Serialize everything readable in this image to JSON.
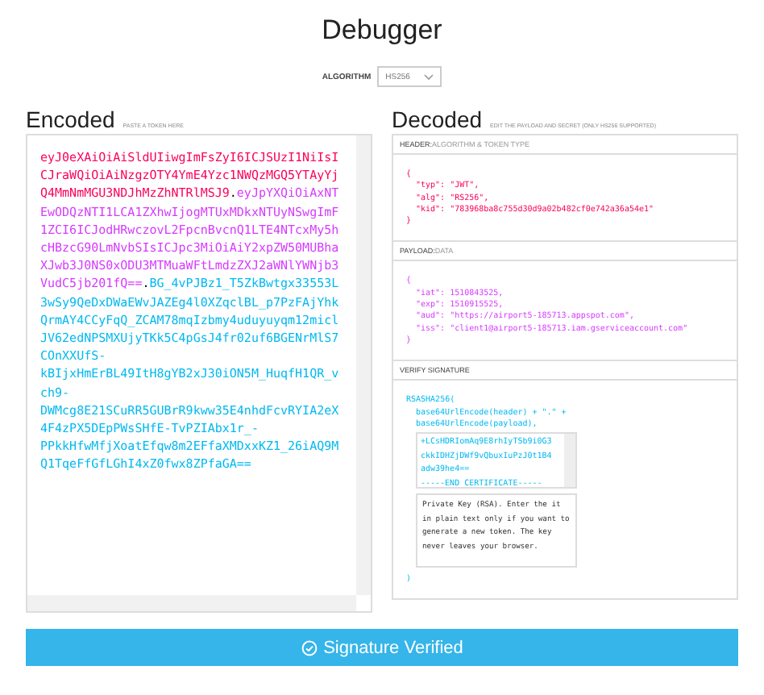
{
  "title": "Debugger",
  "algorithm": {
    "label": "ALGORITHM",
    "value": "HS256"
  },
  "encoded": {
    "heading": "Encoded",
    "hint": "PASTE A TOKEN HERE",
    "lines": [
      [
        {
          "color": "#fb015b",
          "text": "eyJ0eXAiOiAiSldUIiwgImFsZyI6ICJSUzI1NiIsI"
        }
      ],
      [
        {
          "color": "#fb015b",
          "text": "CJraWQiOiAiNzgzOTY4YmE4Yzc1NWQzMGQ5YTAyYj"
        }
      ],
      [
        {
          "color": "#fb015b",
          "text": "Q4MmNmMGU3NDJhMzZhNTRlMSJ9"
        },
        {
          "text": "."
        },
        {
          "color": "#d63aff",
          "text": "eyJpYXQiOiAxNT"
        }
      ],
      [
        {
          "color": "#d63aff",
          "text": "EwODQzNTI1LCA1ZXhwIjogMTUxMDkxNTUyNSwgImF"
        }
      ],
      [
        {
          "color": "#d63aff",
          "text": "1ZCI6ICJodHRwczovL2FpcnBvcnQ1LTE4NTcxMy5h"
        }
      ],
      [
        {
          "color": "#d63aff",
          "text": "cHBzcG90LmNvbSIsICJpc3MiOiAiY2xpZW50MUBha"
        }
      ],
      [
        {
          "color": "#d63aff",
          "text": "XJwb3J0NS0xODU3MTMuaWFtLmdzZXJ2aWNlYWNjb3"
        }
      ],
      [
        {
          "color": "#d63aff",
          "text": "VudC5jb201fQ=="
        },
        {
          "text": "."
        },
        {
          "color": "#00b9f1",
          "text": "BG_4vPJBz1_T5ZkBwtgx33553L"
        }
      ],
      [
        {
          "color": "#00b9f1",
          "text": "3wSy9QeDxDWaEWvJAZEg4l0XZqclBL_p7PzFAjYhk"
        }
      ],
      [
        {
          "color": "#00b9f1",
          "text": "QrmAY4CCyFqQ_ZCAM78mqIzbmy4uduyuyqm12micl"
        }
      ],
      [
        {
          "color": "#00b9f1",
          "text": "JV62edNPSMXUjyTKk5C4pGsJ4fr02uf6BGENrMlS7"
        }
      ],
      [
        {
          "color": "#00b9f1",
          "text": "COnXXUfS-"
        }
      ],
      [
        {
          "color": "#00b9f1",
          "text": "kBIjxHmErBL49ItH8gYB2xJ30iON5M_HuqfH1QR_v"
        }
      ],
      [
        {
          "color": "#00b9f1",
          "text": "ch9-"
        }
      ],
      [
        {
          "color": "#00b9f1",
          "text": "DWMcg8E21SCuRR5GUBrR9kww35E4nhdFcvRYIA2eX"
        }
      ],
      [
        {
          "color": "#00b9f1",
          "text": "4F4zPX5DEpPWsSHfE-TvPZIAbx1r_-"
        }
      ],
      [
        {
          "color": "#00b9f1",
          "text": "PPkkHfwMfjXoatEfqw8m2EFfaXMDxxKZ1_26iAQ9M"
        }
      ],
      [
        {
          "color": "#00b9f1",
          "text": "Q1TqeFfGfLGhI4xZ0fwx8ZPfaGA=="
        }
      ]
    ]
  },
  "decoded": {
    "heading": "Decoded",
    "hint": "EDIT THE PAYLOAD AND SECRET (ONLY HS256 SUPPORTED)",
    "sections": [
      {
        "kind": "json",
        "color": "#fb015b",
        "title": "HEADER:",
        "subtitle": "ALGORITHM & TOKEN TYPE",
        "open": "{",
        "close": "}",
        "fields": [
          {
            "key": "\"typ\":",
            "value": "\"JWT\","
          },
          {
            "key": "\"alg\":",
            "value": "\"RS256\","
          },
          {
            "key": "\"kid\":",
            "value": "\"783968ba8c755d30d9a02b482cf0e742a36a54e1\""
          }
        ]
      },
      {
        "kind": "json",
        "color": "#d63aff",
        "title": "PAYLOAD:",
        "subtitle": "DATA",
        "open": "{",
        "close": "}",
        "fields": [
          {
            "key": "\"iat\":",
            "value": "1510843525,"
          },
          {
            "key": "\"exp\":",
            "value": "1510915525,"
          },
          {
            "key": "\"aud\":",
            "value": "\"https://airport5-185713.appspot.com\","
          },
          {
            "key": "\"iss\":",
            "value": "\"client1@airport5-185713.iam.gserviceaccount.com\""
          }
        ]
      },
      {
        "kind": "verify",
        "color": "#00b9f1",
        "title": "VERIFY SIGNATURE",
        "lines": [
          "RSASHA256(",
          "base64UrlEncode(header) + \".\" +",
          "base64UrlEncode(payload),"
        ],
        "public_key": [
          "+LCsHDRIomAq9E8rhIyTSb9i0G3",
          "ckkIDHZjDWf9vQbuxIuPzJ0t1B4",
          "adw39he4==",
          "-----END CERTIFICATE-----"
        ],
        "private_key": {
          "placeholder": "Private Key (RSA). Enter the it in plain text only if you want to generate a new token. The key never leaves your browser."
        },
        "close": ")"
      }
    ]
  },
  "status": {
    "verified": true,
    "label": "Signature Verified"
  }
}
